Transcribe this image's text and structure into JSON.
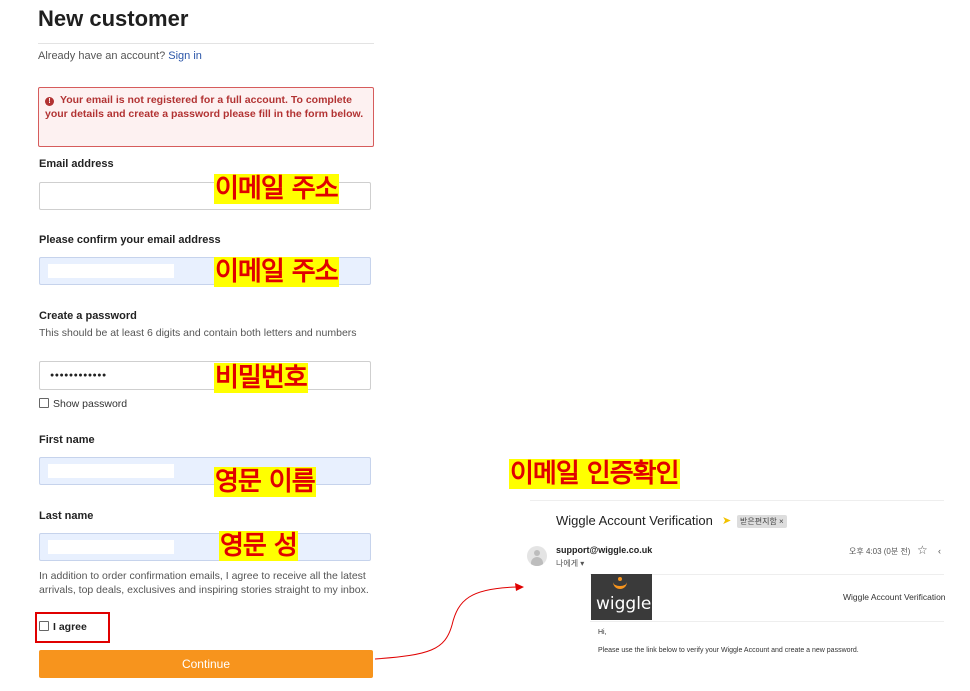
{
  "form": {
    "title": "New customer",
    "signin_prefix": "Already have an account?",
    "signin_link": "Sign in",
    "alert_text": "Your email is not registered for a full account. To complete your details and create a password please fill in the form below.",
    "email_label": "Email address",
    "confirm_email_label": "Please confirm your email address",
    "password_label": "Create a password",
    "password_hint": "This should be at least 6 digits and contain both letters and numbers",
    "password_value": "●●●●●●●●●●●●",
    "show_password_label": "Show password",
    "first_name_label": "First name",
    "last_name_label": "Last name",
    "consent_text": "In addition to order confirmation emails, I agree to receive all the latest arrivals, top deals, exclusives and inspiring stories straight to my inbox.",
    "agree_label": "I agree",
    "continue_label": "Continue"
  },
  "annotations": {
    "email": "이메일 주소",
    "confirm_email": "이메일 주소",
    "password": "비밀번호",
    "first_name": "영문 이름",
    "last_name": "영문 성",
    "verify": "이메일 인증확인"
  },
  "email_preview": {
    "subject": "Wiggle Account Verification",
    "tag": "받은편지함 ×",
    "from": "support@wiggle.co.uk",
    "to": "나에게 ▾",
    "time": "오후 4:03 (0분 전)",
    "logo_text": "wiggle",
    "header_right": "Wiggle Account Verification",
    "greeting": "Hi,",
    "message": "Please use the link below to verify your Wiggle Account and create a new password."
  },
  "colors": {
    "accent_orange": "#f7941d",
    "alert_red": "#b23333",
    "highlight_yellow": "#ffff00",
    "annotation_red": "#e00000"
  }
}
